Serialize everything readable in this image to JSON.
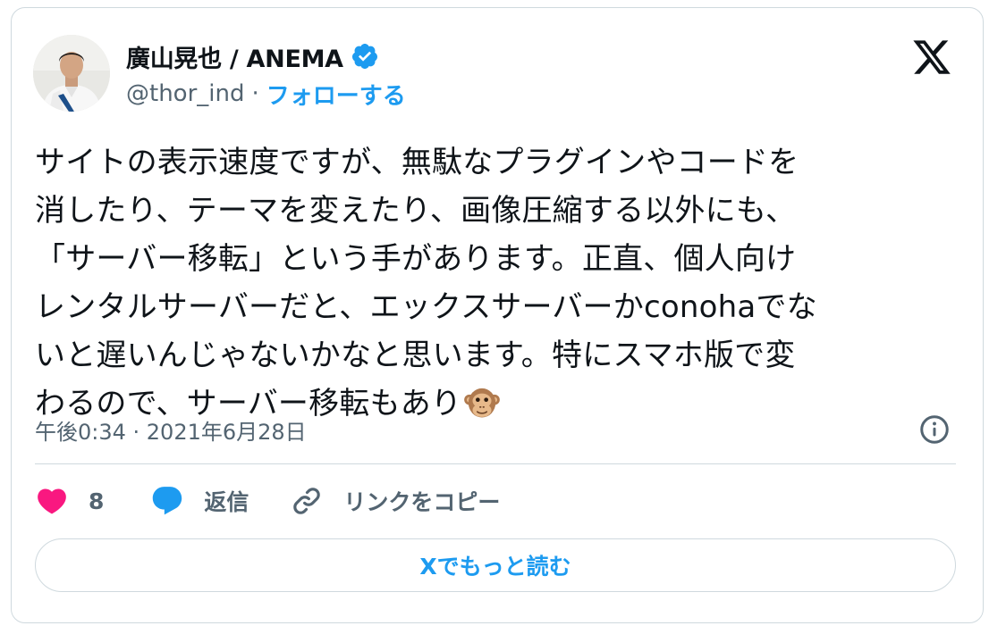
{
  "author": {
    "name": "廣山晃也 / ANEMA",
    "handle": "@thor_ind",
    "separator": "·",
    "follow_label": "フォローする"
  },
  "tweet": {
    "lines": [
      "サイトの表示速度ですが、無駄なプラグインやコードを",
      "消したり、テーマを変えたり、画像圧縮する以外にも、",
      "「サーバー移転」という手があります。正直、個人向け",
      "レンタルサーバーだと、エックスサーバーかconohaでな",
      "いと遅いんじゃないかなと思います。特にスマホ版で変",
      "わるので、サーバー移転もあり"
    ],
    "emoji": "monkey-face-icon",
    "timestamp": "午後0:34 · 2021年6月28日"
  },
  "actions": {
    "like_count": "8",
    "reply_label": "返信",
    "copy_link_label": "リンクをコピー"
  },
  "read_more_label": "Xでもっと読む",
  "colors": {
    "accent": "#1d9bf0",
    "like": "#f91880",
    "text": "#0f1419",
    "muted": "#536471",
    "border": "#cfd9de"
  }
}
